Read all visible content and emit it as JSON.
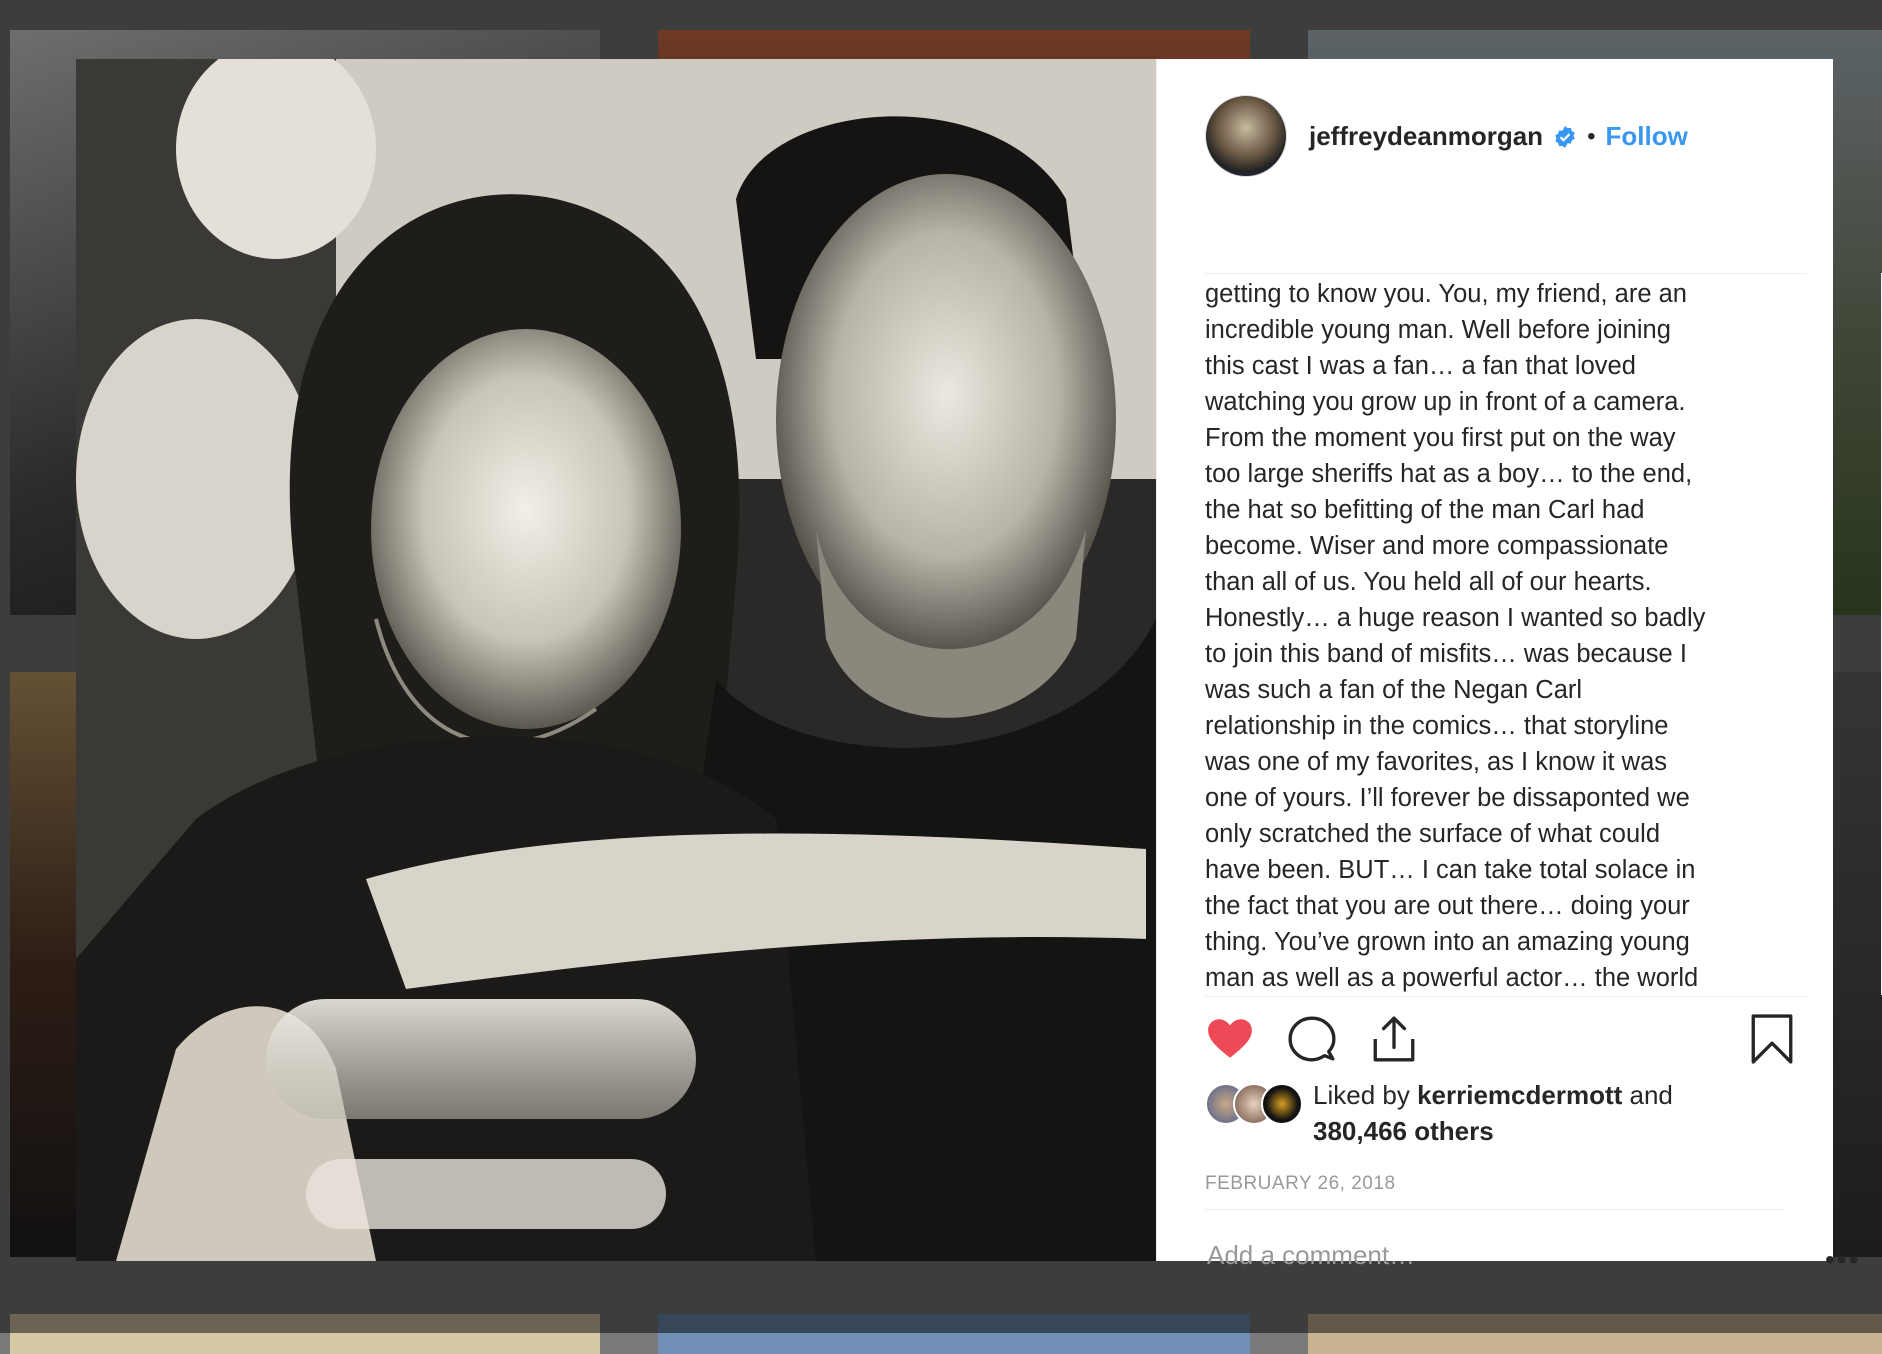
{
  "post": {
    "username": "jeffreydeanmorgan",
    "dot": "•",
    "follow_label": "Follow",
    "caption": "getting to know you. You, my friend, are an\nincredible young man. Well before joining\nthis cast I was a fan… a fan that loved\nwatching you grow up in front of a camera.\nFrom the moment you first put on the way\ntoo large sheriffs hat as a boy… to the end,\nthe hat so befitting of the man Carl had\nbecome. Wiser and more compassionate\nthan all of us. You held all of our hearts.\nHonestly… a huge reason I wanted so badly\nto join this band of misfits… was because I\nwas such a fan of the Negan Carl\nrelationship in the comics… that storyline\nwas one of my favorites, as I know it was\none of yours. I’ll forever be dissaponted we\nonly scratched the surface of what could\nhave been. BUT… I can take total solace in\nthe fact that you are out there… doing your\nthing. You’ve grown into an amazing young\nman as well as a powerful actor… the world",
    "liked_prefix": "Liked by ",
    "liked_user": "kerriemcdermott",
    "liked_and": " and",
    "liked_count": "380,466 others",
    "date": "FEBRUARY 26, 2018",
    "comment_placeholder": "Add a comment…",
    "more_label": "•••"
  },
  "scrollbar": {
    "up_arrow": "▲",
    "down_arrow": "▼"
  },
  "icons": {
    "like": "heart-icon",
    "comment": "comment-icon",
    "share": "share-icon",
    "save": "bookmark-icon",
    "verified": "verified-badge-icon"
  },
  "colors": {
    "like_red": "#ed4956",
    "follow_blue": "#3897f0",
    "verified_blue": "#3897f0"
  }
}
